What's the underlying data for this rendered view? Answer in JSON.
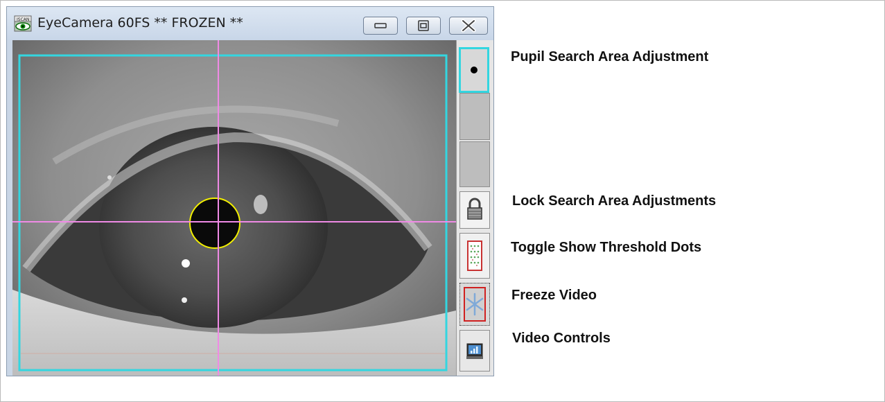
{
  "window": {
    "title": "EyeCamera 60FS ** FROZEN **",
    "title_icon": "eyecamera-app-icon",
    "buttons": [
      "minimize",
      "maximize",
      "close"
    ]
  },
  "toolbar": {
    "buttons": [
      {
        "name": "pupil-search-area-button",
        "icon": "black-dot-icon"
      },
      {
        "name": "search-area-slot-1",
        "icon": ""
      },
      {
        "name": "search-area-slot-2",
        "icon": ""
      },
      {
        "name": "lock-search-area-button",
        "icon": "padlock-icon"
      },
      {
        "name": "threshold-dots-button",
        "icon": "dot-grid-icon"
      },
      {
        "name": "freeze-video-button",
        "icon": "snowflake-icon"
      },
      {
        "name": "video-controls-button",
        "icon": "monitor-chart-icon"
      }
    ]
  },
  "labels": {
    "pupil": "Pupil Search Area Adjustment",
    "lock": "Lock Search Area Adjustments",
    "threshold": "Toggle Show Threshold Dots",
    "freeze": "Freeze Video",
    "video": "Video Controls"
  },
  "colors": {
    "search_box": "#33d6e0",
    "crosshair": "#f08ae6",
    "pupil_ring": "#f3f000",
    "pupil_fill": "#0a0a0a"
  }
}
